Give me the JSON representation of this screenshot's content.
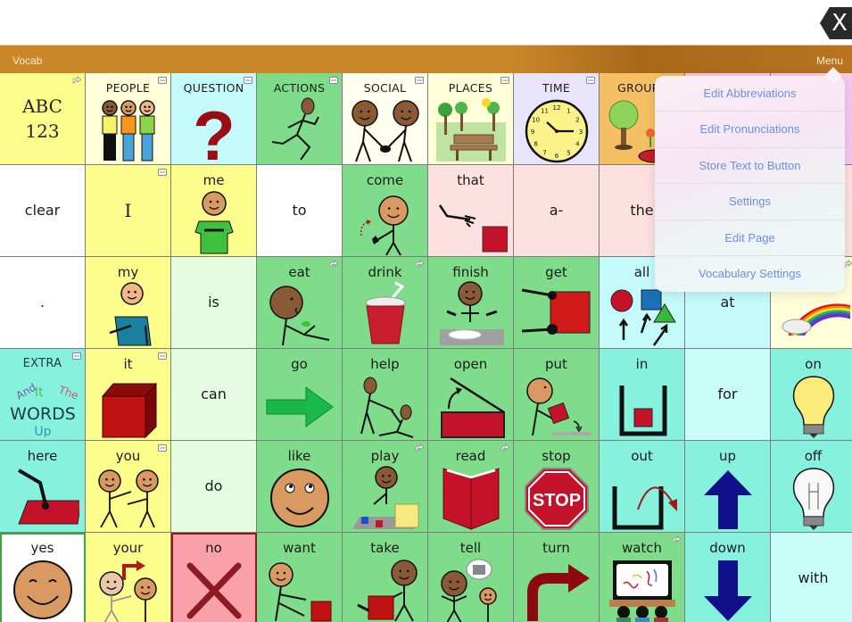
{
  "window": {
    "close_button": "X"
  },
  "header": {
    "title": "Vocab",
    "menu_label": "Menu"
  },
  "menu": {
    "items": [
      "Edit Abbreviations",
      "Edit Pronunciations",
      "Store Text to Button",
      "Settings",
      "Edit Page",
      "Vocabulary Settings"
    ]
  },
  "grid": {
    "rows": [
      [
        {
          "label": "ABC\n123",
          "icon": "abc-123-icon",
          "color": "yellow",
          "corner": "link-icon"
        },
        {
          "label": "PEOPLE",
          "icon": "people-icon",
          "color": "paleyellow",
          "corner": "folder-icon"
        },
        {
          "label": "QUESTION",
          "icon": "question-mark-icon",
          "color": "cyan",
          "corner": "folder-icon"
        },
        {
          "label": "ACTIONS",
          "icon": "running-person-icon",
          "color": "green",
          "corner": "folder-icon"
        },
        {
          "label": "SOCIAL",
          "icon": "handshake-icon",
          "color": "cream",
          "corner": "folder-icon"
        },
        {
          "label": "PLACES",
          "icon": "park-bench-icon",
          "color": "paleyellow",
          "corner": "folder-icon"
        },
        {
          "label": "TIME",
          "icon": "clock-icon",
          "color": "lavender",
          "corner": "folder-icon"
        },
        {
          "label": "GROUPS",
          "icon": "tree-flower-icon",
          "color": "orange",
          "corner": ""
        },
        {
          "label": "",
          "icon": "",
          "color": "pink",
          "corner": ""
        },
        {
          "label": "",
          "icon": "",
          "color": "pink",
          "corner": ""
        }
      ],
      [
        {
          "label": "clear",
          "icon": "",
          "color": "white",
          "corner": ""
        },
        {
          "label": "I",
          "icon": "",
          "color": "yellow",
          "corner": "folder-icon"
        },
        {
          "label": "me",
          "icon": "person-self-icon",
          "color": "yellow",
          "corner": ""
        },
        {
          "label": "to",
          "icon": "",
          "color": "white",
          "corner": ""
        },
        {
          "label": "come",
          "icon": "beckoning-person-icon",
          "color": "green",
          "corner": ""
        },
        {
          "label": "that",
          "icon": "pointing-at-square-icon",
          "color": "rose",
          "corner": ""
        },
        {
          "label": "a-",
          "icon": "",
          "color": "rose",
          "corner": ""
        },
        {
          "label": "the",
          "icon": "",
          "color": "rose",
          "corner": ""
        },
        {
          "label": "",
          "icon": "",
          "color": "rose",
          "corner": ""
        },
        {
          "label": "",
          "icon": "",
          "color": "rose",
          "corner": ""
        }
      ],
      [
        {
          "label": ".",
          "icon": "",
          "color": "white",
          "corner": ""
        },
        {
          "label": "my",
          "icon": "person-hand-on-chest-icon",
          "color": "yellow",
          "corner": ""
        },
        {
          "label": "is",
          "icon": "",
          "color": "palegreen",
          "corner": ""
        },
        {
          "label": "eat",
          "icon": "eating-person-icon",
          "color": "green",
          "corner": "link-icon"
        },
        {
          "label": "drink",
          "icon": "cup-straw-icon",
          "color": "green",
          "corner": "link-icon"
        },
        {
          "label": "finish",
          "icon": "finished-plate-icon",
          "color": "green",
          "corner": ""
        },
        {
          "label": "get",
          "icon": "grab-square-icon",
          "color": "green",
          "corner": ""
        },
        {
          "label": "all",
          "icon": "shapes-arrows-icon",
          "color": "cyan",
          "corner": ""
        },
        {
          "label": "at",
          "icon": "",
          "color": "cyan",
          "corner": ""
        },
        {
          "label": "",
          "icon": "rainbow-icon",
          "color": "paleyellow",
          "corner": "link-icon"
        }
      ],
      [
        {
          "label": "EXTRA",
          "icon": "extra-words-icon",
          "color": "teal",
          "corner": "folder-icon"
        },
        {
          "label": "it",
          "icon": "red-cube-icon",
          "color": "yellow",
          "corner": "folder-icon"
        },
        {
          "label": "can",
          "icon": "",
          "color": "palegreen",
          "corner": ""
        },
        {
          "label": "go",
          "icon": "green-arrow-right-icon",
          "color": "green",
          "corner": ""
        },
        {
          "label": "help",
          "icon": "helping-people-icon",
          "color": "green",
          "corner": ""
        },
        {
          "label": "open",
          "icon": "open-box-icon",
          "color": "green",
          "corner": ""
        },
        {
          "label": "put",
          "icon": "putting-box-icon",
          "color": "green",
          "corner": ""
        },
        {
          "label": "in",
          "icon": "box-in-container-icon",
          "color": "teal",
          "corner": ""
        },
        {
          "label": "for",
          "icon": "",
          "color": "lightcyan",
          "corner": ""
        },
        {
          "label": "on",
          "icon": "lightbulb-on-icon",
          "color": "teal",
          "corner": ""
        }
      ],
      [
        {
          "label": "here",
          "icon": "pointing-down-mat-icon",
          "color": "teal",
          "corner": ""
        },
        {
          "label": "you",
          "icon": "pointing-people-icon",
          "color": "yellow",
          "corner": "folder-icon"
        },
        {
          "label": "do",
          "icon": "",
          "color": "palegreen",
          "corner": ""
        },
        {
          "label": "like",
          "icon": "happy-face-icon",
          "color": "green",
          "corner": ""
        },
        {
          "label": "play",
          "icon": "playing-blocks-icon",
          "color": "green",
          "corner": "link-icon"
        },
        {
          "label": "read",
          "icon": "open-book-icon",
          "color": "green",
          "corner": "link-icon"
        },
        {
          "label": "stop",
          "icon": "stop-sign-icon",
          "color": "green",
          "corner": ""
        },
        {
          "label": "out",
          "icon": "arrow-out-container-icon",
          "color": "teal",
          "corner": ""
        },
        {
          "label": "up",
          "icon": "arrow-up-icon",
          "color": "teal",
          "corner": ""
        },
        {
          "label": "off",
          "icon": "lightbulb-off-icon",
          "color": "teal",
          "corner": ""
        }
      ],
      [
        {
          "label": "yes",
          "icon": "smiling-face-icon",
          "color": "white",
          "corner": "",
          "sel": "green"
        },
        {
          "label": "your",
          "icon": "your-people-icon",
          "color": "yellow",
          "corner": ""
        },
        {
          "label": "no",
          "icon": "red-x-icon",
          "color": "red",
          "corner": "",
          "sel": "red"
        },
        {
          "label": "want",
          "icon": "reaching-square-icon",
          "color": "green",
          "corner": ""
        },
        {
          "label": "take",
          "icon": "taking-square-icon",
          "color": "green",
          "corner": ""
        },
        {
          "label": "tell",
          "icon": "telling-people-icon",
          "color": "green",
          "corner": ""
        },
        {
          "label": "turn",
          "icon": "turn-arrow-icon",
          "color": "green",
          "corner": ""
        },
        {
          "label": "watch",
          "icon": "watching-screen-icon",
          "color": "green",
          "corner": "link-icon"
        },
        {
          "label": "down",
          "icon": "arrow-down-icon",
          "color": "teal",
          "corner": ""
        },
        {
          "label": "with",
          "icon": "",
          "color": "lightcyan",
          "corner": ""
        }
      ]
    ]
  },
  "extra_words": [
    "And",
    "It",
    "The",
    "WORDS",
    "Up"
  ],
  "stop_sign_text": "STOP",
  "clock_numbers": [
    "12",
    "1",
    "2",
    "3",
    "4",
    "5",
    "6",
    "7",
    "8",
    "9",
    "10",
    "11"
  ]
}
